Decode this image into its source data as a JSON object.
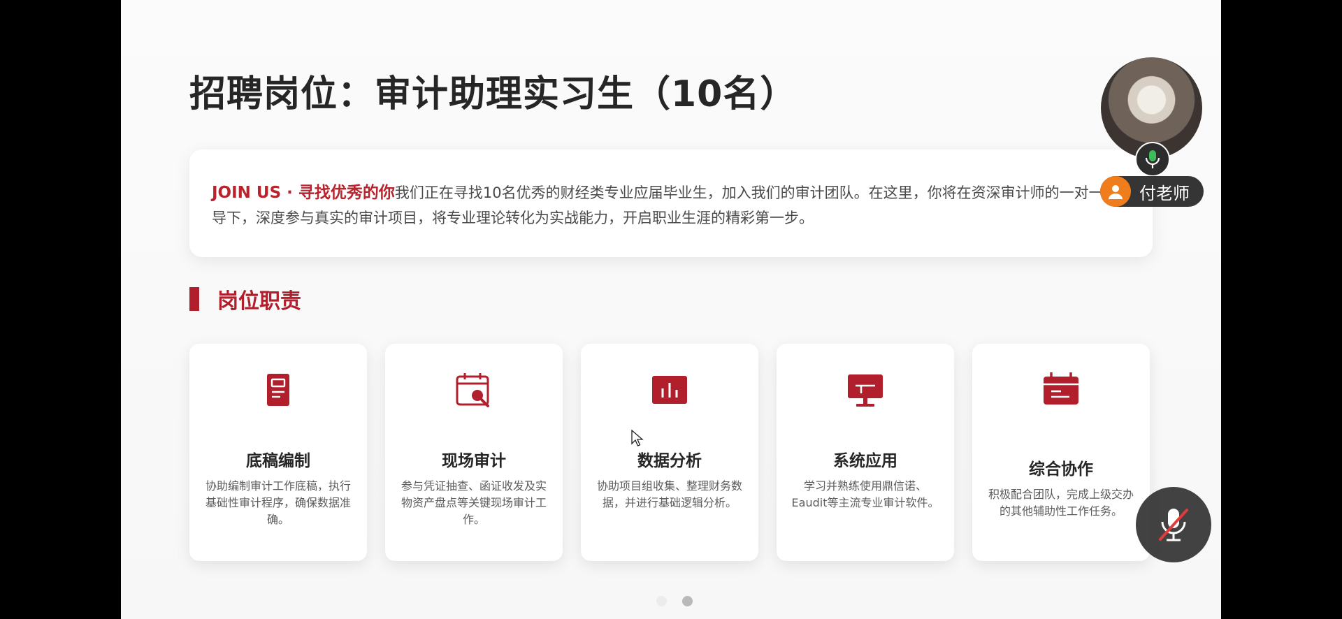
{
  "slide": {
    "title": "招聘岗位：审计助理实习生（10名）",
    "intro": {
      "accent": "JOIN US · 寻找优秀的你",
      "text": "我们正在寻找10名优秀的财经类专业应届毕业生，加入我们的审计团队。在这里，你将在资深审计师的一对一指导下，深度参与真实的审计项目，将专业理论转化为实战能力，开启职业生涯的精彩第一步。"
    },
    "section_title": "岗位职责",
    "cards": [
      {
        "title": "底稿编制",
        "desc": "协助编制审计工作底稿，执行基础性审计程序，确保数据准确。",
        "icon": "document-icon"
      },
      {
        "title": "现场审计",
        "desc": "参与凭证抽查、函证收发及实物资产盘点等关键现场审计工作。",
        "icon": "calendar-search-icon"
      },
      {
        "title": "数据分析",
        "desc": "协助项目组收集、整理财务数据，并进行基础逻辑分析。",
        "icon": "bar-chart-icon"
      },
      {
        "title": "系统应用",
        "desc": "学习并熟练使用鼎信诺、Eaudit等主流专业审计软件。",
        "icon": "monitor-icon"
      },
      {
        "title": "综合协作",
        "desc": "积极配合团队，完成上级交办的其他辅助性工作任务。",
        "icon": "calendar-icon"
      }
    ],
    "pager": {
      "total": 2,
      "active": 2
    }
  },
  "meeting": {
    "speaker_name": "付老师",
    "accent_color": "#b01f2b",
    "avatar_color": "#f07d1b"
  }
}
